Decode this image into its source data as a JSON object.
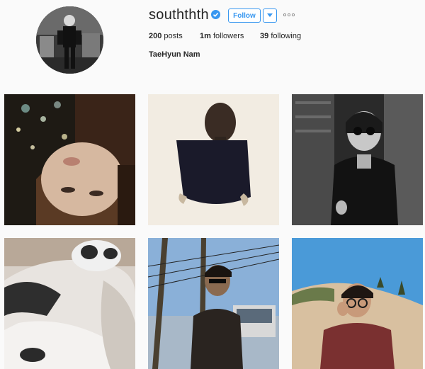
{
  "profile": {
    "username": "souththth",
    "verified_icon": "verified-badge-icon",
    "follow_label": "Follow",
    "dropdown_icon": "caret-down-icon",
    "more_icon": "more-options-icon",
    "posts_count": "200",
    "posts_label": "posts",
    "followers_count": "1m",
    "followers_label": "followers",
    "following_count": "39",
    "following_label": "following",
    "full_name": "TaeHyun Nam"
  },
  "colors": {
    "accent": "#3897f0",
    "text": "#262626",
    "background": "#fafafa"
  },
  "posts": [
    {
      "subject": "upside-down portrait with bokeh lights"
    },
    {
      "subject": "sculpture head on dark pedestal"
    },
    {
      "subject": "black and white portrait with sunglasses"
    },
    {
      "subject": "sleeping black and white cat"
    },
    {
      "subject": "man in sunglasses with power lines and parked car"
    },
    {
      "subject": "portrait with round glasses on hillside"
    }
  ]
}
